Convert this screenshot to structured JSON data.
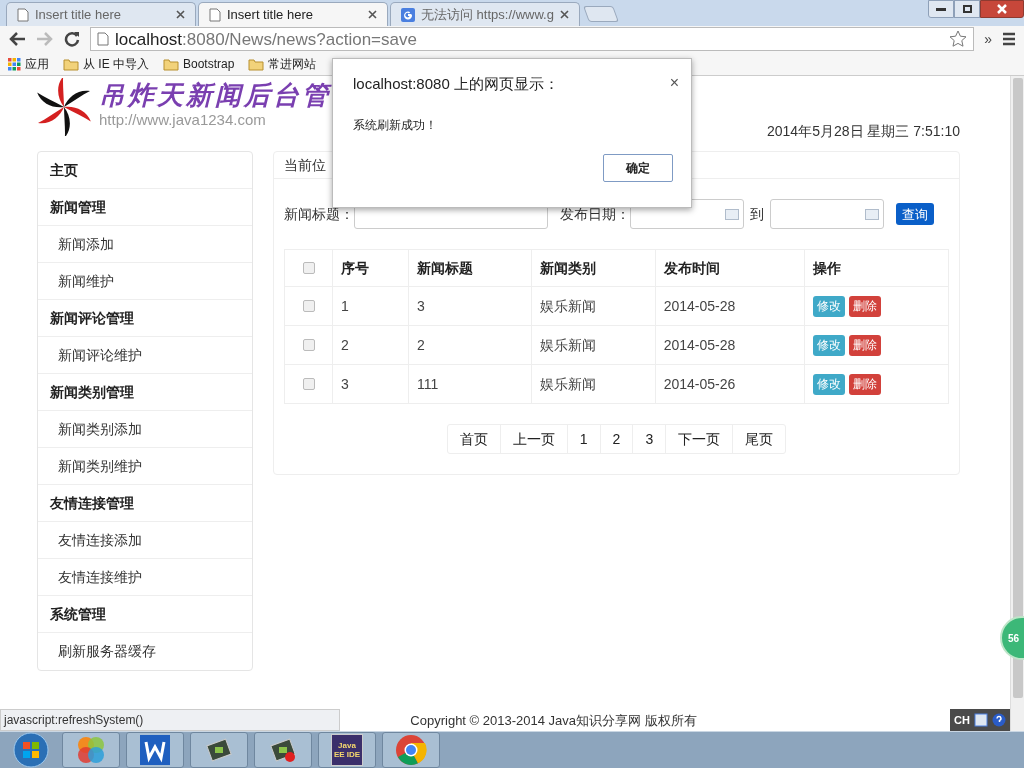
{
  "browser": {
    "tabs": [
      {
        "title": "Insert title here",
        "selected": false,
        "kind": "page"
      },
      {
        "title": "Insert title here",
        "selected": true,
        "kind": "page"
      },
      {
        "title": "无法访问 https://www.g",
        "selected": false,
        "kind": "google"
      }
    ],
    "url_host": "localhost",
    "url_rest": ":8080/News/news?action=save",
    "bookmarks": [
      {
        "label": "应用",
        "kind": "apps"
      },
      {
        "label": "从 IE 中导入",
        "kind": "folder"
      },
      {
        "label": "Bootstrap",
        "kind": "folder"
      },
      {
        "label": "常进网站",
        "kind": "folder"
      }
    ],
    "more": "»"
  },
  "header": {
    "logo_text": "吊炸天新闻后台管",
    "logo_url": "http://www.java1234.com",
    "datetime": "2014年5月28日 星期三 7:51:10"
  },
  "sidebar": [
    {
      "label": "主页",
      "kind": "group"
    },
    {
      "label": "新闻管理",
      "kind": "group"
    },
    {
      "label": "新闻添加",
      "kind": "item"
    },
    {
      "label": "新闻维护",
      "kind": "item"
    },
    {
      "label": "新闻评论管理",
      "kind": "group"
    },
    {
      "label": "新闻评论维护",
      "kind": "item"
    },
    {
      "label": "新闻类别管理",
      "kind": "group"
    },
    {
      "label": "新闻类别添加",
      "kind": "item"
    },
    {
      "label": "新闻类别维护",
      "kind": "item"
    },
    {
      "label": "友情连接管理",
      "kind": "group"
    },
    {
      "label": "友情连接添加",
      "kind": "item"
    },
    {
      "label": "友情连接维护",
      "kind": "item"
    },
    {
      "label": "系统管理",
      "kind": "group"
    },
    {
      "label": "刷新服务器缓存",
      "kind": "item"
    }
  ],
  "breadcrumb": "当前位",
  "search": {
    "title_label": "新闻标题：",
    "date_label": "发布日期：",
    "to_label": "到",
    "button": "查询"
  },
  "table": {
    "columns": [
      "序号",
      "新闻标题",
      "新闻类别",
      "发布时间",
      "操作"
    ],
    "header_checked": false,
    "rows": [
      {
        "checked": false,
        "cells": [
          "1",
          "3",
          "娱乐新闻",
          "2014-05-28"
        ],
        "edit": "修改",
        "delete": "删除"
      },
      {
        "checked": false,
        "cells": [
          "2",
          "2",
          "娱乐新闻",
          "2014-05-28"
        ],
        "edit": "修改",
        "delete": "删除"
      },
      {
        "checked": false,
        "cells": [
          "3",
          "111",
          "娱乐新闻",
          "2014-05-26"
        ],
        "edit": "修改",
        "delete": "删除"
      }
    ]
  },
  "pagination": [
    {
      "label": "首页",
      "selected": false
    },
    {
      "label": "上一页",
      "selected": false
    },
    {
      "label": "1",
      "selected": false
    },
    {
      "label": "2",
      "selected": false
    },
    {
      "label": "3",
      "selected": false
    },
    {
      "label": "下一页",
      "selected": false
    },
    {
      "label": "尾页",
      "selected": false
    }
  ],
  "footer": "Copyright © 2013-2014 Java知识分享网 版权所有",
  "status_bar": "javascript:refreshSystem()",
  "dialog": {
    "title": "localhost:8080 上的网页显示：",
    "close": "×",
    "message": "系统刷新成功！",
    "ok": "确定"
  },
  "floating_badge": "56",
  "tray": {
    "language": "CH"
  },
  "taskbar": [
    {
      "kind": "start"
    },
    {
      "kind": "colors"
    },
    {
      "kind": "w"
    },
    {
      "kind": "chip"
    },
    {
      "kind": "chip-red"
    },
    {
      "kind": "javaee",
      "label": "Java EE IDE"
    },
    {
      "kind": "chrome"
    }
  ]
}
